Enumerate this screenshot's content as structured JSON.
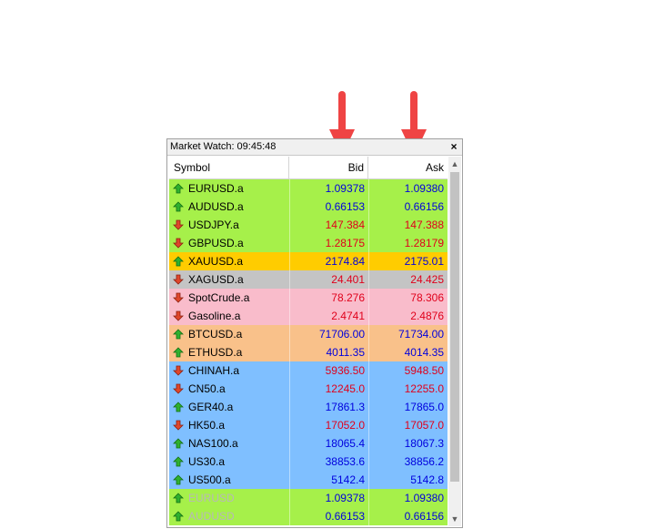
{
  "window": {
    "title": "Market Watch: 09:45:48"
  },
  "columns": {
    "symbol": "Symbol",
    "bid": "Bid",
    "ask": "Ask"
  },
  "colors": {
    "green": "#a6f04a",
    "gold": "#ffcc00",
    "gray": "#c4c4c4",
    "pink": "#f9bccb",
    "orange": "#f9c18a",
    "blue": "#7fbfff",
    "text_blue": "#0000dd",
    "text_red": "#e0001b",
    "arrow_red": "#ef4444"
  },
  "rows": [
    {
      "symbol": "EURUSD.a",
      "bid": "1.09378",
      "ask": "1.09380",
      "trend": "up",
      "bg": "green",
      "color": "blue"
    },
    {
      "symbol": "AUDUSD.a",
      "bid": "0.66153",
      "ask": "0.66156",
      "trend": "up",
      "bg": "green",
      "color": "blue"
    },
    {
      "symbol": "USDJPY.a",
      "bid": "147.384",
      "ask": "147.388",
      "trend": "down",
      "bg": "green",
      "color": "red"
    },
    {
      "symbol": "GBPUSD.a",
      "bid": "1.28175",
      "ask": "1.28179",
      "trend": "down",
      "bg": "green",
      "color": "red"
    },
    {
      "symbol": "XAUUSD.a",
      "bid": "2174.84",
      "ask": "2175.01",
      "trend": "up",
      "bg": "gold",
      "color": "blue"
    },
    {
      "symbol": "XAGUSD.a",
      "bid": "24.401",
      "ask": "24.425",
      "trend": "down",
      "bg": "gray",
      "color": "red"
    },
    {
      "symbol": "SpotCrude.a",
      "bid": "78.276",
      "ask": "78.306",
      "trend": "down",
      "bg": "pink",
      "color": "red"
    },
    {
      "symbol": "Gasoline.a",
      "bid": "2.4741",
      "ask": "2.4876",
      "trend": "down",
      "bg": "pink",
      "color": "red"
    },
    {
      "symbol": "BTCUSD.a",
      "bid": "71706.00",
      "ask": "71734.00",
      "trend": "up",
      "bg": "orange",
      "color": "blue"
    },
    {
      "symbol": "ETHUSD.a",
      "bid": "4011.35",
      "ask": "4014.35",
      "trend": "up",
      "bg": "orange",
      "color": "blue"
    },
    {
      "symbol": "CHINAH.a",
      "bid": "5936.50",
      "ask": "5948.50",
      "trend": "down",
      "bg": "blue",
      "color": "red"
    },
    {
      "symbol": "CN50.a",
      "bid": "12245.0",
      "ask": "12255.0",
      "trend": "down",
      "bg": "blue",
      "color": "red"
    },
    {
      "symbol": "GER40.a",
      "bid": "17861.3",
      "ask": "17865.0",
      "trend": "up",
      "bg": "blue",
      "color": "blue"
    },
    {
      "symbol": "HK50.a",
      "bid": "17052.0",
      "ask": "17057.0",
      "trend": "down",
      "bg": "blue",
      "color": "red"
    },
    {
      "symbol": "NAS100.a",
      "bid": "18065.4",
      "ask": "18067.3",
      "trend": "up",
      "bg": "blue",
      "color": "blue"
    },
    {
      "symbol": "US30.a",
      "bid": "38853.6",
      "ask": "38856.2",
      "trend": "up",
      "bg": "blue",
      "color": "blue"
    },
    {
      "symbol": "US500.a",
      "bid": "5142.4",
      "ask": "5142.8",
      "trend": "up",
      "bg": "blue",
      "color": "blue"
    },
    {
      "symbol": "EURUSD",
      "bid": "1.09378",
      "ask": "1.09380",
      "trend": "up",
      "bg": "green",
      "color": "blue",
      "disabled": true
    },
    {
      "symbol": "AUDUSD",
      "bid": "0.66153",
      "ask": "0.66156",
      "trend": "up",
      "bg": "green",
      "color": "blue",
      "disabled": true
    }
  ],
  "annotations": [
    {
      "name": "bid-pointer-arrow-icon"
    },
    {
      "name": "ask-pointer-arrow-icon"
    }
  ]
}
